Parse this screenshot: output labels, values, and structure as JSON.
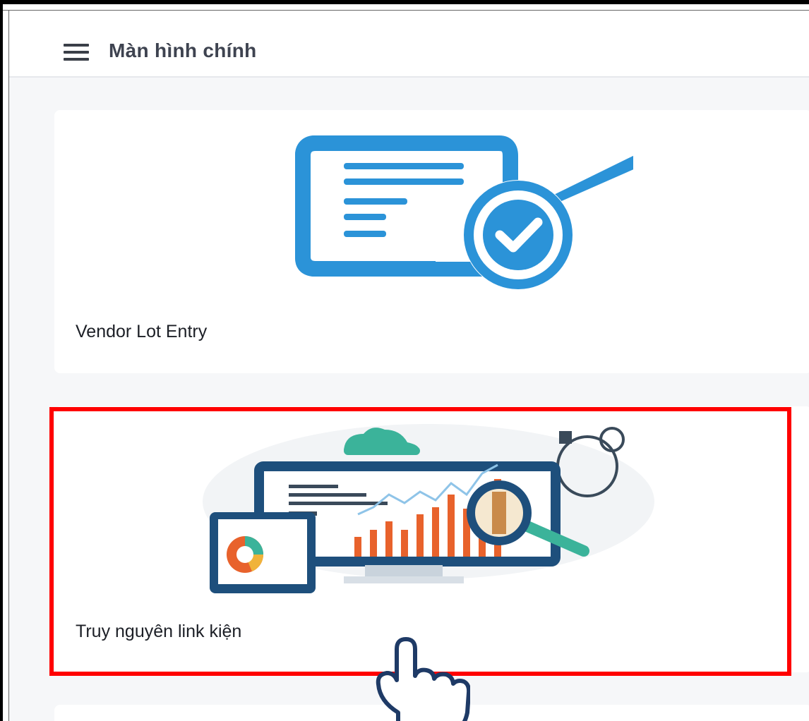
{
  "header": {
    "menu_icon": "hamburger-menu-icon",
    "title": "Màn hình chính"
  },
  "cards": [
    {
      "label": "Vendor Lot Entry",
      "icon": "document-check-icon"
    },
    {
      "label": "Truy nguyên link kiện",
      "icon": "analytics-dashboard-icon",
      "highlighted": true
    }
  ],
  "colors": {
    "highlight": "#ff0000",
    "doc_blue": "#2b93d8",
    "accent_orange": "#e8622c",
    "navy": "#1e4f7c",
    "teal": "#3bb39a"
  }
}
